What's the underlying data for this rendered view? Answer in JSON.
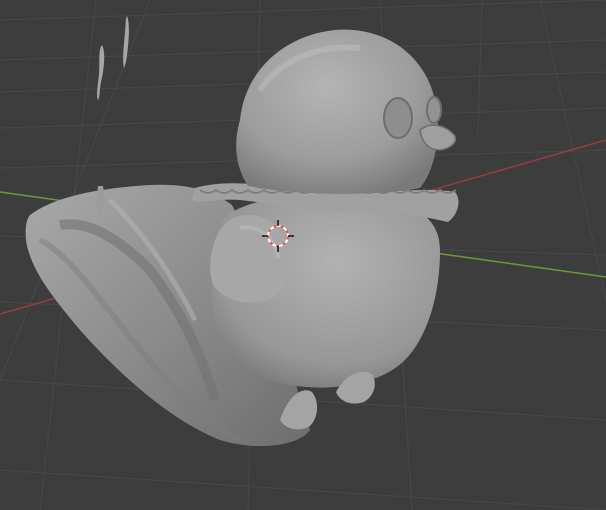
{
  "viewport": {
    "background_color": "#3d3d3d",
    "grid_color": "#4a4a4a",
    "x_axis_color": "#9b3b44",
    "y_axis_color": "#6a9a34",
    "model_color": "#9a9a9a",
    "model_highlight_color": "#b3b3b3",
    "model_shadow_color": "#6c6c6c"
  },
  "scene": {
    "object": "3d-sculpt-bird-mesh",
    "cursor": "3d-cursor-icon"
  }
}
